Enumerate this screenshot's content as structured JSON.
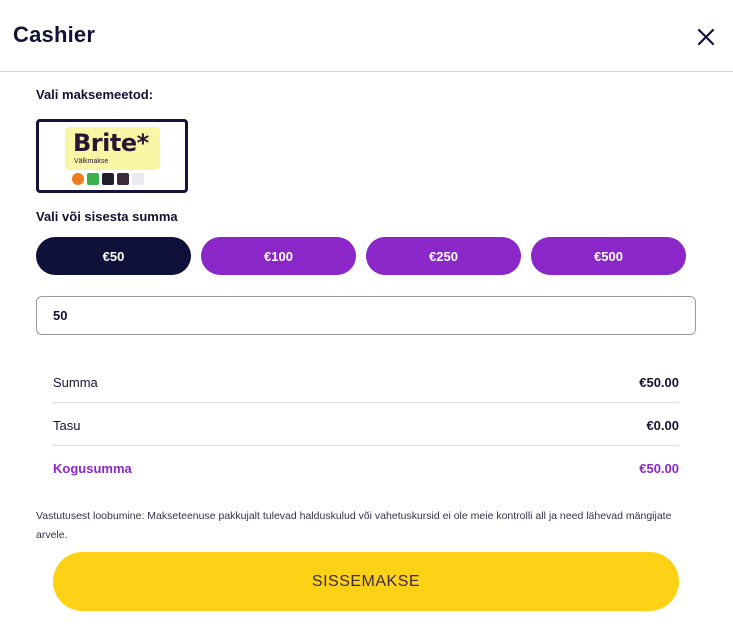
{
  "header": {
    "title": "Cashier",
    "close_icon": "close-icon"
  },
  "payment": {
    "label": "Vali maksemeetod:",
    "method": {
      "brand": "Brite*",
      "subtitle": "Välkmakse",
      "colors": {
        "brand_bg": "#f7f7a6",
        "border": "#14143a"
      }
    }
  },
  "amounts": {
    "label": "Vali või sisesta summa",
    "options": [
      "€50",
      "€100",
      "€250",
      "€500"
    ],
    "selected": "€50",
    "colors": {
      "active": "#10113a",
      "inactive": "#8b27c9"
    }
  },
  "input": {
    "value": "50"
  },
  "summary": {
    "rows": [
      {
        "label": "Summa",
        "value": "€50.00"
      },
      {
        "label": "Tasu",
        "value": "€0.00"
      },
      {
        "label": "Kogusumma",
        "value": "€50.00"
      }
    ],
    "colors": {
      "total": "#8b27c9"
    }
  },
  "disclaimer": "Vastutusest loobumine: Makseteenuse pakkujalt tulevad halduskulud või vahetuskursid ei ole meie kontrolli all ja need lähevad mängijate arvele.",
  "deposit": {
    "label": "SISSEMAKSE",
    "color": "#fcd116"
  }
}
